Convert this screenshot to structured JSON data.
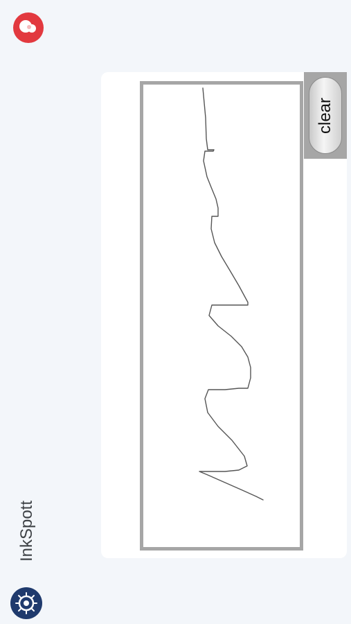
{
  "app": {
    "name": "InkSpott"
  },
  "toolbar": {
    "clear_label": "clear"
  },
  "icons": {
    "top_logo": "red-circle-logo-icon",
    "bottom_logo": "inkspott-logo-icon"
  },
  "colors": {
    "accent_red": "#e2393f",
    "logo_navy": "#1f3a6d",
    "frame_gray": "#a6a6a6",
    "ink": "#555555"
  }
}
